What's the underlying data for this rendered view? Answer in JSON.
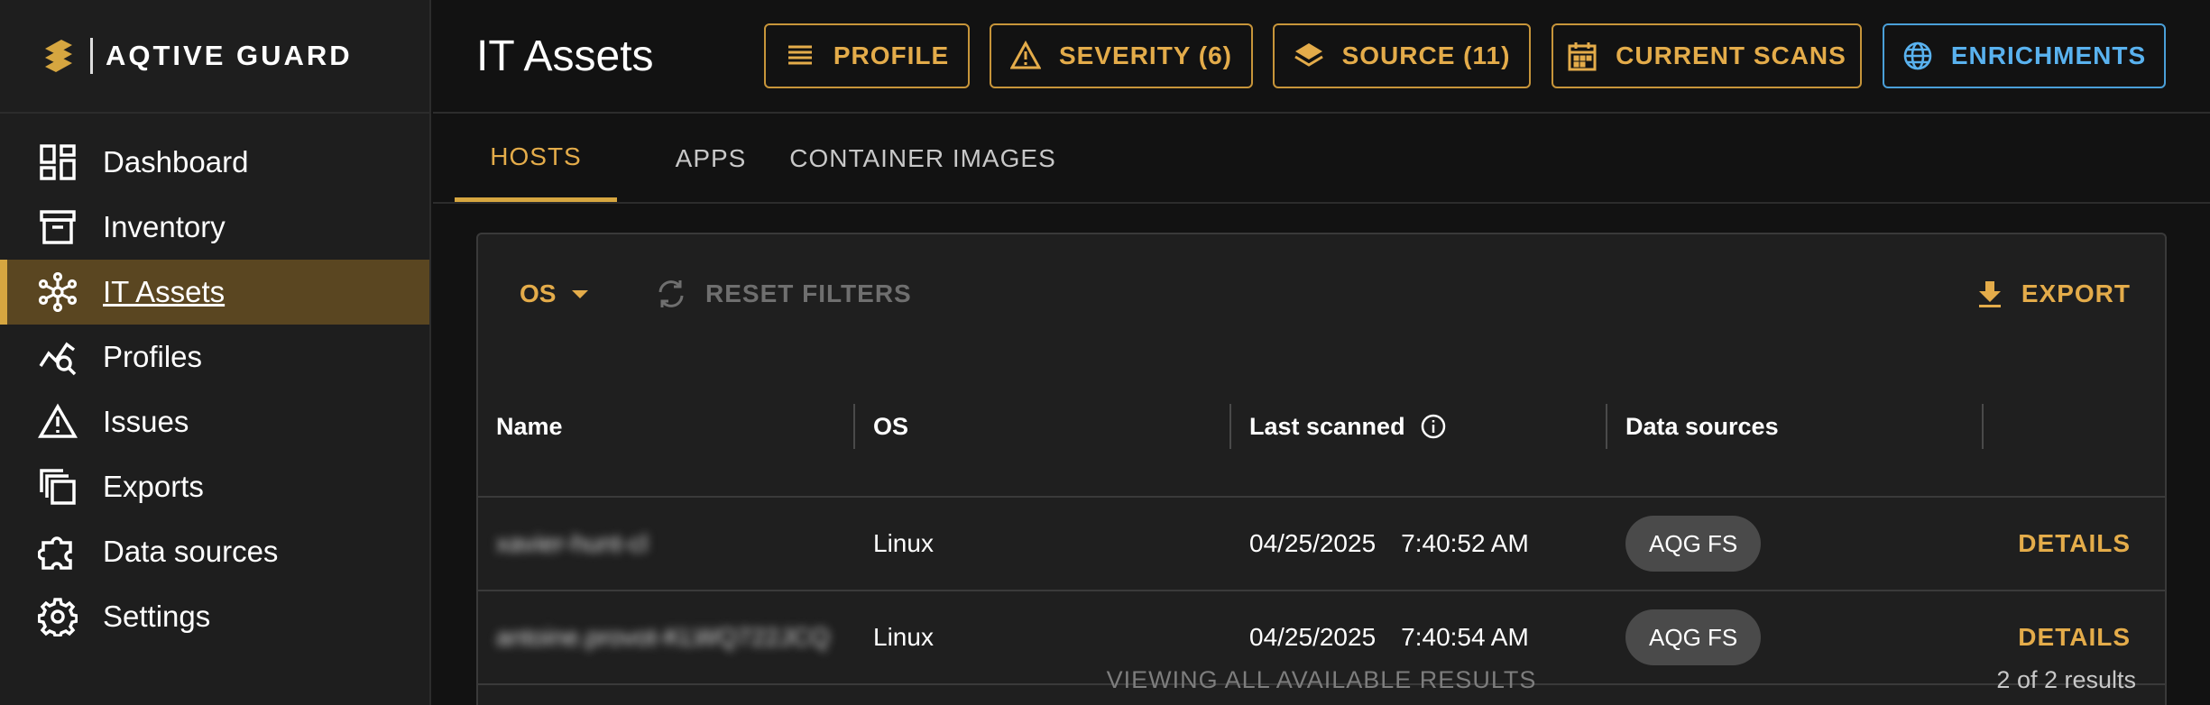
{
  "app": {
    "brand": "AQTIVE GUARD"
  },
  "sidebar": {
    "items": [
      {
        "label": "Dashboard",
        "icon": "dashboard-icon"
      },
      {
        "label": "Inventory",
        "icon": "inventory-icon"
      },
      {
        "label": "IT Assets",
        "icon": "network-icon",
        "active": true
      },
      {
        "label": "Profiles",
        "icon": "profiles-icon"
      },
      {
        "label": "Issues",
        "icon": "warning-icon"
      },
      {
        "label": "Exports",
        "icon": "copy-icon"
      },
      {
        "label": "Data sources",
        "icon": "puzzle-icon"
      },
      {
        "label": "Settings",
        "icon": "gear-icon"
      }
    ]
  },
  "header": {
    "title": "IT Assets",
    "buttons": {
      "profile": "PROFILE",
      "severity": "SEVERITY (6)",
      "source": "SOURCE (11)",
      "current_scans": "CURRENT SCANS",
      "enrichments": "ENRICHMENTS"
    }
  },
  "tabs": [
    {
      "label": "HOSTS",
      "active": true
    },
    {
      "label": "APPS"
    },
    {
      "label": "CONTAINER IMAGES"
    }
  ],
  "toolbar": {
    "os_filter": "OS",
    "reset_filters": "RESET FILTERS",
    "export": "EXPORT"
  },
  "table": {
    "columns": [
      "Name",
      "OS",
      "Last scanned",
      "Data sources"
    ],
    "rows": [
      {
        "name": "xavier-hunt-cl",
        "os": "Linux",
        "date": "04/25/2025",
        "time": "7:40:52 AM",
        "source": "AQG FS",
        "action": "DETAILS"
      },
      {
        "name": "antoine.provot-KLWQ722JCQ",
        "os": "Linux",
        "date": "04/25/2025",
        "time": "7:40:54 AM",
        "source": "AQG FS",
        "action": "DETAILS"
      }
    ],
    "footer_note": "VIEWING ALL AVAILABLE RESULTS",
    "result_count": "2 of 2 results"
  },
  "colors": {
    "accent": "#e4ac4a",
    "accent_blue": "#59b2ef",
    "active_nav_bg": "#5a4621",
    "background": "#121212",
    "sidebar_bg": "#1e1e1e",
    "card_bg": "#1f1f1f"
  }
}
